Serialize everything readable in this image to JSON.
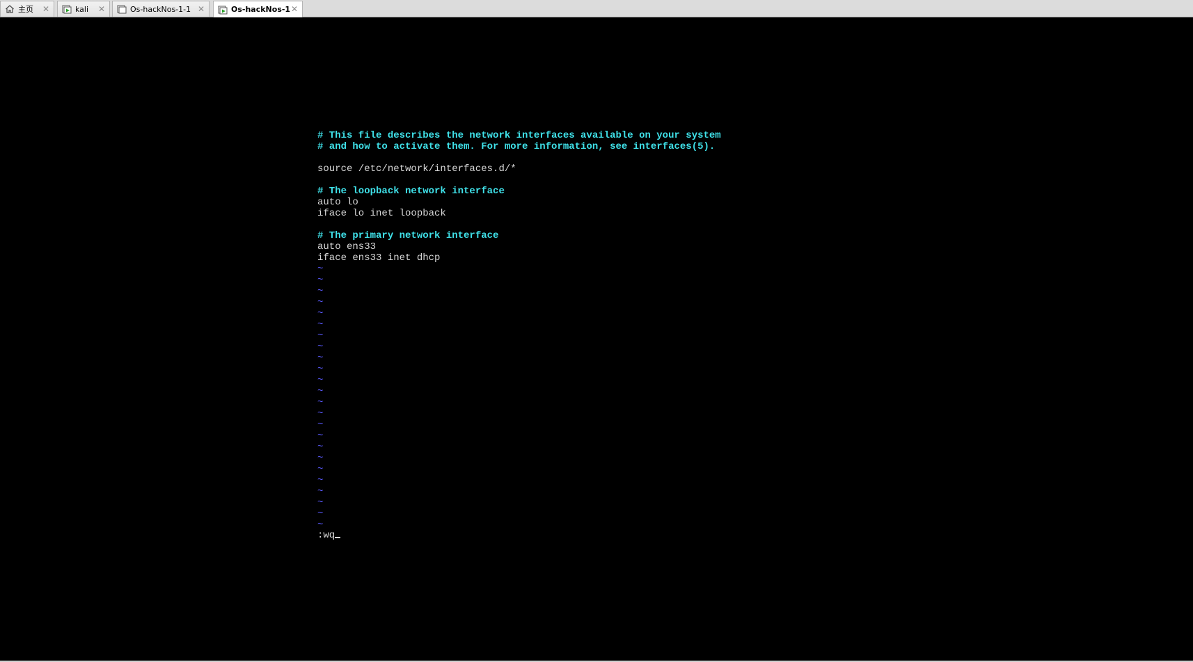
{
  "tabs": [
    {
      "label": "主页",
      "icon": "home-icon"
    },
    {
      "label": "kali",
      "icon": "vm-running-icon"
    },
    {
      "label": "Os-hackNos-1-1",
      "icon": "vm-icon"
    },
    {
      "label": "Os-hackNos-1",
      "icon": "vm-running-icon",
      "active": true
    }
  ],
  "editor": {
    "lines": [
      {
        "type": "comment",
        "text": "# This file describes the network interfaces available on your system"
      },
      {
        "type": "comment",
        "text": "# and how to activate them. For more information, see interfaces(5)."
      },
      {
        "type": "text",
        "text": ""
      },
      {
        "type": "text",
        "text": "source /etc/network/interfaces.d/*"
      },
      {
        "type": "text",
        "text": ""
      },
      {
        "type": "comment",
        "text": "# The loopback network interface"
      },
      {
        "type": "text",
        "text": "auto lo"
      },
      {
        "type": "text",
        "text": "iface lo inet loopback"
      },
      {
        "type": "text",
        "text": ""
      },
      {
        "type": "comment",
        "text": "# The primary network interface"
      },
      {
        "type": "text",
        "text": "auto ens33"
      },
      {
        "type": "text",
        "text": "iface ens33 inet dhcp"
      }
    ],
    "empty_line_marker": "~",
    "empty_line_count": 24,
    "command_line": ":wq"
  },
  "colors": {
    "comment": "#3fe0e8",
    "text": "#d8d8d8",
    "tilde": "#5a5aff",
    "background": "#000000"
  }
}
